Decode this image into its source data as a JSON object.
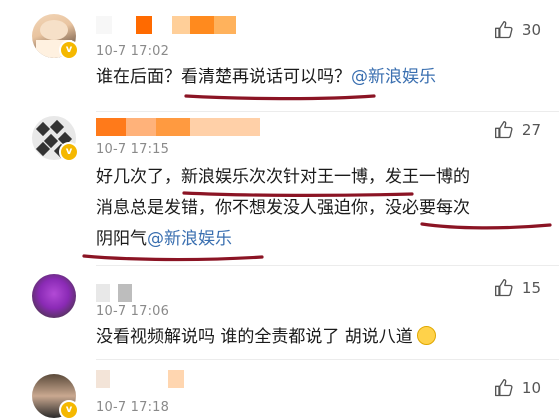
{
  "comments": [
    {
      "time": "10-7 17:02",
      "likes": "30",
      "text": "谁在后面？看清楚再说话可以吗？",
      "mention": "@新浪娱乐",
      "redacted_name_colors": [
        "#f7f7f7",
        "#ff6a00",
        "#ffcf99",
        "#ff8a1e",
        "#ffb25c"
      ]
    },
    {
      "time": "10-7 17:15",
      "likes": "27",
      "lines": [
        "好几次了，新浪娱乐次次针对王一博，发王一博的",
        "消息总是发错，你不想发没人强迫你，没必要每次",
        "阴阳气"
      ],
      "mention": "@新浪娱乐",
      "redacted_name_colors": [
        "#ff7a1a",
        "#ffb27a",
        "#ff9a40",
        "#ffd0a8"
      ]
    },
    {
      "time": "10-7 17:06",
      "likes": "15",
      "text": "没看视频解说吗 谁的全责都说了 胡说八道",
      "emoji": "shushing-face-emoji",
      "redacted_name_colors": [
        "#bdbdbd",
        "#e8e8e8"
      ]
    },
    {
      "time": "10-7 17:18",
      "likes": "10",
      "redacted_name_colors": [
        "#f3e4d8",
        "#ffd6b0"
      ]
    }
  ],
  "colors": {
    "annotation_underline": "#8b1424",
    "mention": "#3a6fb0",
    "verified_badge": "#f5b800"
  }
}
